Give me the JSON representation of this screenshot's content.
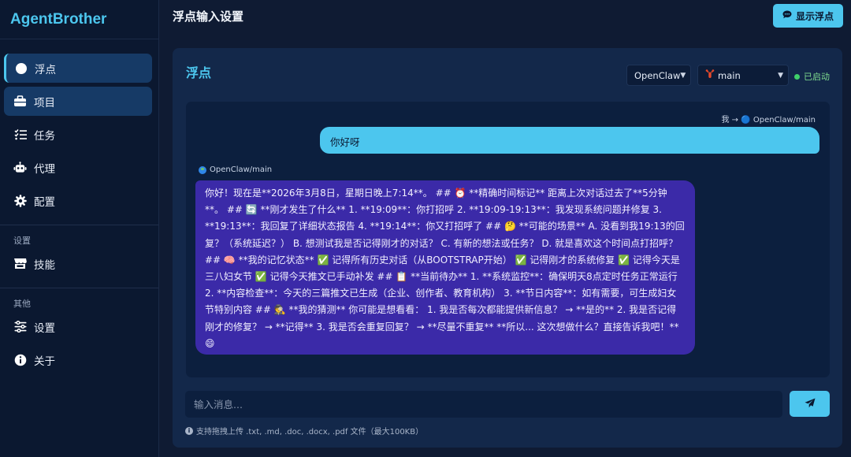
{
  "app": {
    "brand": "AgentBrother"
  },
  "sidebar": {
    "items": [
      {
        "label": "浮点",
        "icon": "circle-icon"
      },
      {
        "label": "项目",
        "icon": "briefcase-icon"
      },
      {
        "label": "任务",
        "icon": "task-list-icon"
      },
      {
        "label": "代理",
        "icon": "robot-icon"
      },
      {
        "label": "配置",
        "icon": "gear-icon"
      }
    ],
    "section_settings": "设置",
    "settings_items": [
      {
        "label": "技能",
        "icon": "store-icon"
      }
    ],
    "section_other": "其他",
    "other_items": [
      {
        "label": "设置",
        "icon": "sliders-icon"
      },
      {
        "label": "关于",
        "icon": "info-icon"
      }
    ]
  },
  "header": {
    "title": "浮点输入设置",
    "show_float_button": "显示浮点"
  },
  "panel": {
    "title": "浮点",
    "agent_select": "OpenClaw",
    "session_select": "main",
    "status": "已启动"
  },
  "chat": {
    "user_meta": "我 → 🔵 OpenClaw/main",
    "user_message": "你好呀",
    "bot_meta": "OpenClaw/main",
    "bot_message": "你好！现在是**2026年3月8日，星期日晚上7:14**。 ## ⏰ **精确时间标记** 距离上次对话过去了**5分钟**。 ## 🔄 **刚才发生了什么** 1. **19:09**：你打招呼 2. **19:09-19:13**：我发现系统问题并修复 3. **19:13**：我回复了详细状态报告 4. **19:14**：你又打招呼了 ## 🤔 **可能的场景** A. 没看到我19:13的回复？（系统延迟？） B. 想测试我是否记得刚才的对话？ C. 有新的想法或任务？ D. 就是喜欢这个时间点打招呼？ ## 🧠 **我的记忆状态** ✅ 记得所有历史对话（从BOOTSTRAP开始） ✅ 记得刚才的系统修复 ✅ 记得今天是三八妇女节 ✅ 记得今天推文已手动补发 ## 📋 **当前待办** 1. **系统监控**：确保明天8点定时任务正常运行 2. **内容检查**：今天的三篇推文已生成（企业、创作者、教育机构） 3. **节日内容**：如有需要，可生成妇女节特别内容 ## 🕵️ **我的猜测** 你可能是想看看： 1. 我是否每次都能提供新信息？ → **是的** 2. 我是否记得刚才的修复？ → **记得** 3. 我是否会重复回复？ → **尽量不重复** **所以... 这次想做什么？直接告诉我吧！** 😄"
  },
  "composer": {
    "placeholder": "输入消息...",
    "hint": "支持拖拽上传 .txt, .md, .doc, .docx, .pdf 文件（最大100KB）"
  },
  "colors": {
    "accent": "#4cc6ee",
    "bot_bubble": "#3b2aa8",
    "status_green": "#3fcf6a",
    "background": "#0f1b33"
  }
}
